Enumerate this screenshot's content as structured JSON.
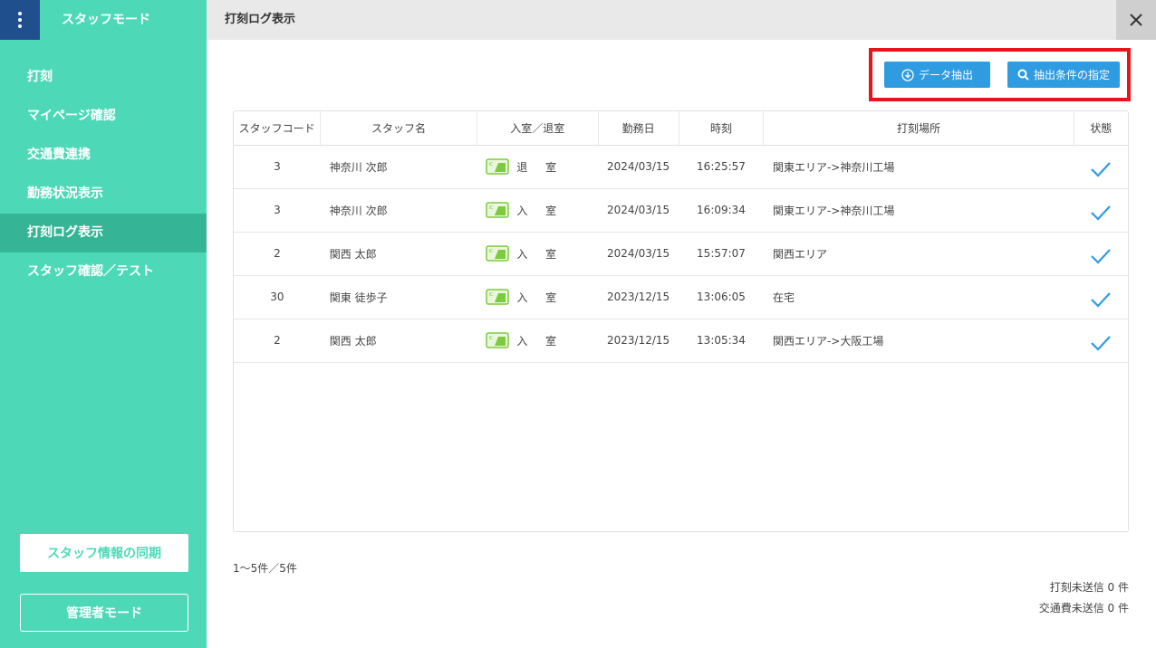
{
  "sidebar": {
    "title": "スタッフモード",
    "items": [
      {
        "label": "打刻"
      },
      {
        "label": "マイページ確認"
      },
      {
        "label": "交通費連携"
      },
      {
        "label": "勤務状況表示"
      },
      {
        "label": "打刻ログ表示",
        "active": true
      },
      {
        "label": "スタッフ確認／テスト"
      }
    ],
    "sync_label": "スタッフ情報の同期",
    "admin_label": "管理者モード"
  },
  "header": {
    "title": "打刻ログ表示"
  },
  "toolbar": {
    "extract_label": "データ抽出",
    "condition_label": "抽出条件の指定"
  },
  "table": {
    "headers": [
      "スタッフコード",
      "スタッフ名",
      "入室／退室",
      "勤務日",
      "時刻",
      "打刻場所",
      "状態"
    ],
    "rows": [
      {
        "code": "3",
        "name": "神奈川 次郎",
        "io": "退 室",
        "date": "2024/03/15",
        "time": "16:25:57",
        "place": "関東エリア->神奈川工場"
      },
      {
        "code": "3",
        "name": "神奈川 次郎",
        "io": "入 室",
        "date": "2024/03/15",
        "time": "16:09:34",
        "place": "関東エリア->神奈川工場"
      },
      {
        "code": "2",
        "name": "関西 太郎",
        "io": "入 室",
        "date": "2024/03/15",
        "time": "15:57:07",
        "place": "関西エリア"
      },
      {
        "code": "30",
        "name": "関東 徒歩子",
        "io": "入 室",
        "date": "2023/12/15",
        "time": "13:06:05",
        "place": "在宅"
      },
      {
        "code": "2",
        "name": "関西 太郎",
        "io": "入 室",
        "date": "2023/12/15",
        "time": "13:05:34",
        "place": "関西エリア->大阪工場"
      }
    ]
  },
  "footer": {
    "count": "1〜5件／5件",
    "pending_stamp": "打刻未送信 0 件",
    "pending_transport": "交通費未送信 0 件"
  },
  "colors": {
    "sidebar_bg": "#4dd9b8",
    "sidebar_active": "#35b596",
    "menu_btn": "#1f4f8c",
    "accent_blue": "#2f9be0",
    "highlight_red": "#e8141c",
    "ic_green": "#7ccb3e"
  }
}
